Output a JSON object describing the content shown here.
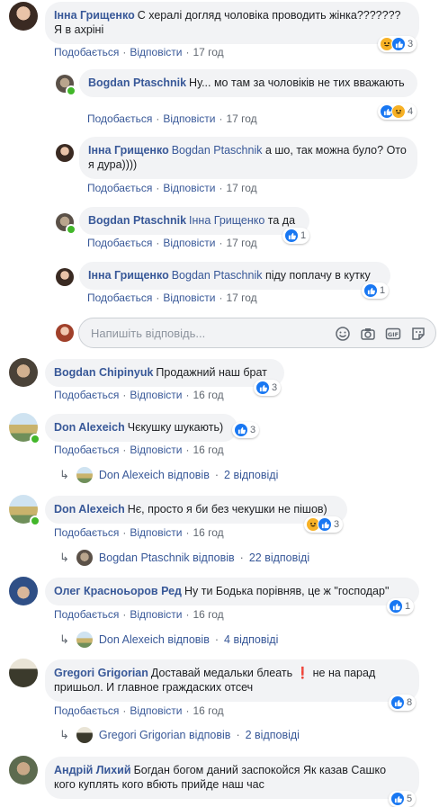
{
  "comments": [
    {
      "name": "Інна Грищенко",
      "text": "С хералі догляд чоловіка проводить жінка??????? Я в ахріні",
      "like": "Подобається",
      "reply": "Відповісти",
      "time": "17 год",
      "reactions": "3"
    },
    {
      "name": "Bogdan Ptaschnik",
      "text": "Ну... мо там за чоловіків не тих вважають",
      "like": "Подобається",
      "reply": "Відповісти",
      "time": "17 год",
      "reactions": "4"
    },
    {
      "name": "Інна Грищенко",
      "mention": "Bogdan Ptaschnik",
      "text": "а шо, так можна було? Ото я дура))))",
      "like": "Подобається",
      "reply": "Відповісти",
      "time": "17 год"
    },
    {
      "name": "Bogdan Ptaschnik",
      "mention": "Інна Грищенко",
      "text": "та да",
      "like": "Подобається",
      "reply": "Відповісти",
      "time": "17 год",
      "reactions": "1"
    },
    {
      "name": "Інна Грищенко",
      "mention": "Bogdan Ptaschnik",
      "text": "піду поплачу в кутку",
      "like": "Подобається",
      "reply": "Відповісти",
      "time": "17 год",
      "reactions": "1"
    },
    {
      "name": "Bogdan Chipinyuk",
      "text": "Продажний наш брат",
      "like": "Подобається",
      "reply": "Відповісти",
      "time": "16 год",
      "reactions": "3"
    },
    {
      "name": "Don Alexeich",
      "text": "Чєкушку шукають)",
      "like": "Подобається",
      "reply": "Відповісти",
      "time": "16 год",
      "reactions": "3",
      "thread_author": "Don Alexeich відповів",
      "thread_count": "2 відповіді"
    },
    {
      "name": "Don Alexeich",
      "text": "Нє, просто я би без чекушки не пішов)",
      "like": "Подобається",
      "reply": "Відповісти",
      "time": "16 год",
      "reactions": "3",
      "thread_author": "Bogdan Ptaschnik відповів",
      "thread_count": "22 відповіді"
    },
    {
      "name": "Олег Красноьоров Ред",
      "text": "Ну ти Бодька порівняв, це ж \"господар\"",
      "like": "Подобається",
      "reply": "Відповісти",
      "time": "16 год",
      "reactions": "1",
      "thread_author": "Don Alexeich відповів",
      "thread_count": "4 відповіді"
    },
    {
      "name": "Gregori Grigorian",
      "text": "Доставай медальки блеать ❗ не на парад пришьол. И главное граждаских отсеч",
      "like": "Подобається",
      "reply": "Відповісти",
      "time": "16 год",
      "reactions": "8",
      "thread_author": "Gregori Grigorian відповів",
      "thread_count": "2 відповіді"
    },
    {
      "name": "Андрій Лихий",
      "text": "Богдан богом даний заспокойся Як казав Сашко кого куплять кого вбють прийде наш час",
      "reactions": "5"
    }
  ],
  "reply_box": {
    "placeholder": "Напишіть відповідь..."
  },
  "colors": {
    "link": "#385898",
    "bubble": "#f2f3f5",
    "like": "#1877f2",
    "online": "#42b72a"
  }
}
